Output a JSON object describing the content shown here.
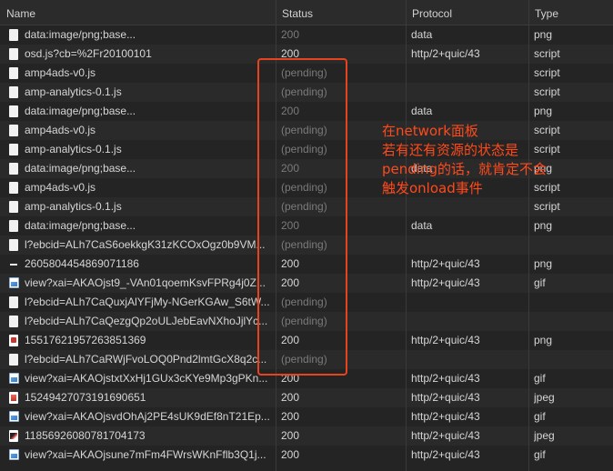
{
  "columns": {
    "name": "Name",
    "status": "Status",
    "protocol": "Protocol",
    "type": "Type"
  },
  "rows": [
    {
      "icon": "document-icon",
      "name": "data:image/png;base...",
      "status": "200",
      "status_dim": true,
      "protocol": "data",
      "type": "png"
    },
    {
      "icon": "document-icon",
      "name": "osd.js?cb=%2Fr20100101",
      "status": "200",
      "status_dim": false,
      "protocol": "http/2+quic/43",
      "type": "script"
    },
    {
      "icon": "document-icon",
      "name": "amp4ads-v0.js",
      "status": "(pending)",
      "status_dim": true,
      "protocol": "",
      "type": "script"
    },
    {
      "icon": "document-icon",
      "name": "amp-analytics-0.1.js",
      "status": "(pending)",
      "status_dim": true,
      "protocol": "",
      "type": "script"
    },
    {
      "icon": "document-icon",
      "name": "data:image/png;base...",
      "status": "200",
      "status_dim": true,
      "protocol": "data",
      "type": "png"
    },
    {
      "icon": "document-icon",
      "name": "amp4ads-v0.js",
      "status": "(pending)",
      "status_dim": true,
      "protocol": "",
      "type": "script"
    },
    {
      "icon": "document-icon",
      "name": "amp-analytics-0.1.js",
      "status": "(pending)",
      "status_dim": true,
      "protocol": "",
      "type": "script"
    },
    {
      "icon": "document-icon",
      "name": "data:image/png;base...",
      "status": "200",
      "status_dim": true,
      "protocol": "data",
      "type": "png"
    },
    {
      "icon": "document-icon",
      "name": "amp4ads-v0.js",
      "status": "(pending)",
      "status_dim": true,
      "protocol": "",
      "type": "script"
    },
    {
      "icon": "document-icon",
      "name": "amp-analytics-0.1.js",
      "status": "(pending)",
      "status_dim": true,
      "protocol": "",
      "type": "script"
    },
    {
      "icon": "document-icon",
      "name": "data:image/png;base...",
      "status": "200",
      "status_dim": true,
      "protocol": "data",
      "type": "png"
    },
    {
      "icon": "document-icon",
      "name": "l?ebcid=ALh7CaS6oekkgK31zKCOxOgz0b9VM...",
      "status": "(pending)",
      "status_dim": true,
      "protocol": "",
      "type": ""
    },
    {
      "icon": "dash-icon",
      "name": "2605804454869071186",
      "status": "200",
      "status_dim": false,
      "protocol": "http/2+quic/43",
      "type": "png"
    },
    {
      "icon": "image-icon",
      "name": "view?xai=AKAOjst9_-VAn01qoemKsvFPRg4j0Z...",
      "status": "200",
      "status_dim": false,
      "protocol": "http/2+quic/43",
      "type": "gif"
    },
    {
      "icon": "document-icon",
      "name": "l?ebcid=ALh7CaQuxjAlYFjMy-NGerKGAw_S6tW...",
      "status": "(pending)",
      "status_dim": true,
      "protocol": "",
      "type": ""
    },
    {
      "icon": "document-icon",
      "name": "l?ebcid=ALh7CaQezgQp2oULJebEavNXhoJjlYc...",
      "status": "(pending)",
      "status_dim": true,
      "protocol": "",
      "type": ""
    },
    {
      "icon": "red-square-icon",
      "name": "15517621957263851369",
      "status": "200",
      "status_dim": false,
      "protocol": "http/2+quic/43",
      "type": "png"
    },
    {
      "icon": "document-icon",
      "name": "l?ebcid=ALh7CaRWjFvoLOQ0Pnd2lmtGcX8q2c...",
      "status": "(pending)",
      "status_dim": true,
      "protocol": "",
      "type": ""
    },
    {
      "icon": "image-icon",
      "name": "view?xai=AKAOjstxtXxHj1GUx3cKYe9Mp3gPKn...",
      "status": "200",
      "status_dim": false,
      "protocol": "http/2+quic/43",
      "type": "gif"
    },
    {
      "icon": "jpeg-icon",
      "name": "15249427073191690651",
      "status": "200",
      "status_dim": false,
      "protocol": "http/2+quic/43",
      "type": "jpeg"
    },
    {
      "icon": "image-icon",
      "name": "view?xai=AKAOjsvdOhAj2PE4sUK9dEf8nT21Ep...",
      "status": "200",
      "status_dim": false,
      "protocol": "http/2+quic/43",
      "type": "gif"
    },
    {
      "icon": "photo-icon",
      "name": "11856926080781704173",
      "status": "200",
      "status_dim": false,
      "protocol": "http/2+quic/43",
      "type": "jpeg"
    },
    {
      "icon": "image-icon",
      "name": "view?xai=AKAOjsune7mFm4FWrsWKnFflb3Q1j...",
      "status": "200",
      "status_dim": false,
      "protocol": "http/2+quic/43",
      "type": "gif"
    }
  ],
  "annotation": {
    "lines": [
      "在network面板",
      "若有还有资源的状态是",
      "pending的话，就肯定不会",
      "触发onload事件"
    ]
  },
  "colors": {
    "annotation": "#ff4a1c",
    "highlight_border": "#e8431f",
    "dim_text": "#7a7a7a"
  }
}
